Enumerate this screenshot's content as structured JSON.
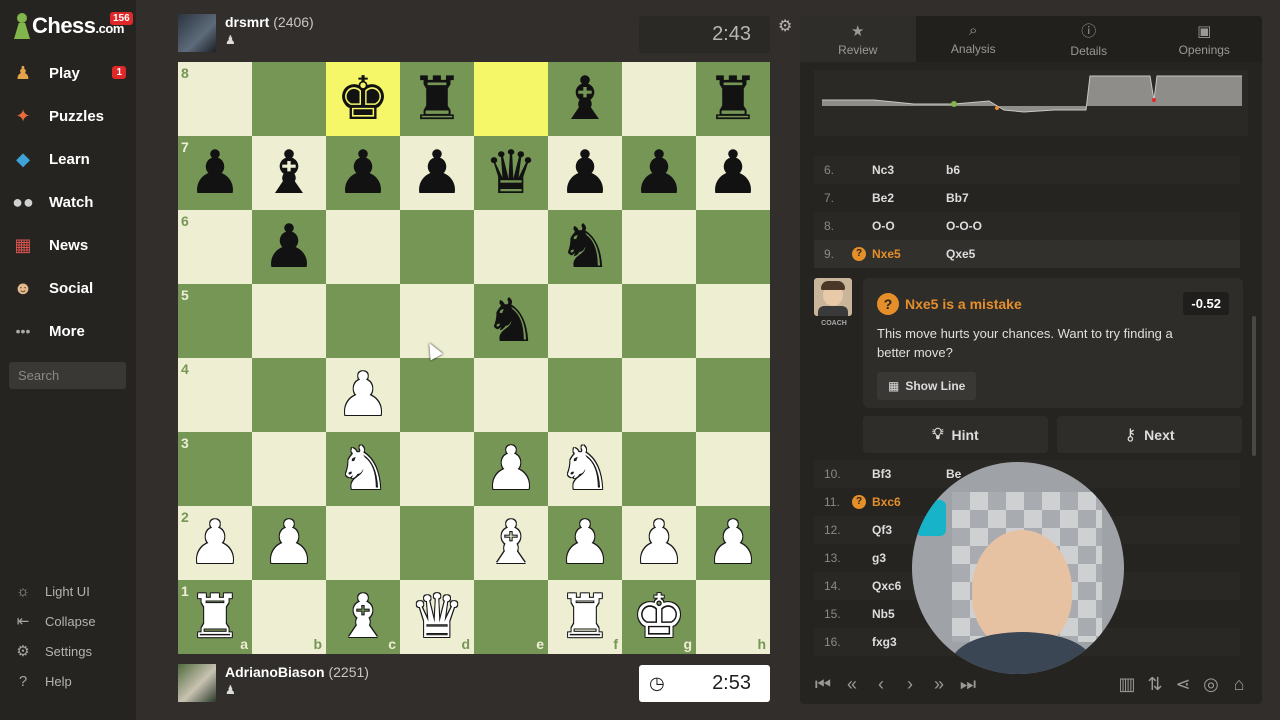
{
  "sidebar": {
    "logo": "Chess",
    "logo_suffix": ".com",
    "logo_badge": "156",
    "nav": [
      {
        "label": "Play",
        "icon": "play-pawn-icon",
        "badge": "1"
      },
      {
        "label": "Puzzles",
        "icon": "puzzle-icon"
      },
      {
        "label": "Learn",
        "icon": "learn-cap-icon"
      },
      {
        "label": "Watch",
        "icon": "binoculars-icon"
      },
      {
        "label": "News",
        "icon": "news-icon"
      },
      {
        "label": "Social",
        "icon": "social-icon"
      },
      {
        "label": "More",
        "icon": "more-dots-icon"
      }
    ],
    "search_placeholder": "Search",
    "footer": [
      "Light UI",
      "Collapse",
      "Settings",
      "Help"
    ]
  },
  "top_player": {
    "name": "drsmrt",
    "rating": "(2406)",
    "clock": "2:43"
  },
  "bottom_player": {
    "name": "AdrianoBiason",
    "rating": "(2251)",
    "clock": "2:53"
  },
  "board": {
    "files": [
      "a",
      "b",
      "c",
      "d",
      "e",
      "f",
      "g",
      "h"
    ],
    "ranks": [
      "8",
      "7",
      "6",
      "5",
      "4",
      "3",
      "2",
      "1"
    ],
    "highlight": [
      "c8",
      "e8"
    ],
    "pieces": {
      "c8": "bk",
      "d8": "br",
      "f8": "bb",
      "h8": "br",
      "a7": "bp",
      "b7": "bb",
      "c7": "bp",
      "d7": "bp",
      "e7": "bq",
      "f7": "bp",
      "g7": "bp",
      "h7": "bp",
      "b6": "bp",
      "f6": "bn",
      "e5": "bn",
      "c4": "wp",
      "c3": "wn",
      "e3": "wp",
      "f3": "wn",
      "a2": "wp",
      "b2": "wp",
      "e2": "wb",
      "f2": "wp",
      "g2": "wp",
      "h2": "wp",
      "a1": "wr",
      "c1": "wb",
      "d1": "wq",
      "f1": "wr",
      "g1": "wk"
    }
  },
  "panel": {
    "tabs": [
      {
        "label": "Review",
        "icon": "star-icon"
      },
      {
        "label": "Analysis",
        "icon": "magnifier-icon"
      },
      {
        "label": "Details",
        "icon": "info-icon"
      },
      {
        "label": "Openings",
        "icon": "book-icon"
      }
    ],
    "moves_top": [
      {
        "num": "6.",
        "white": "Nc3",
        "black": "b6"
      },
      {
        "num": "7.",
        "white": "Be2",
        "black": "Bb7"
      },
      {
        "num": "8.",
        "white": "O-O",
        "black": "O-O-O"
      },
      {
        "num": "9.",
        "white": "Nxe5",
        "black": "Qxe5",
        "mistake": true
      }
    ],
    "coach": {
      "label": "COACH",
      "title": "Nxe5 is a mistake",
      "eval": "-0.52",
      "text": "This move hurts your chances. Want to try finding a better move?",
      "show_line": "Show Line"
    },
    "hint_label": "Hint",
    "next_label": "Next",
    "moves_bottom": [
      {
        "num": "10.",
        "white": "Bf3",
        "black": "Be"
      },
      {
        "num": "11.",
        "white": "Bxc6",
        "black": "",
        "mistake": true
      },
      {
        "num": "12.",
        "white": "Qf3",
        "black": ""
      },
      {
        "num": "13.",
        "white": "g3",
        "black": ""
      },
      {
        "num": "14.",
        "white": "Qxc6",
        "black": ""
      },
      {
        "num": "15.",
        "white": "Nb5",
        "black": ""
      },
      {
        "num": "16.",
        "white": "fxg3",
        "black": ""
      }
    ]
  },
  "colors": {
    "light": "#eeeed2",
    "dark": "#769656",
    "highlight": "#f6f669",
    "mistake": "#e58f2a"
  }
}
